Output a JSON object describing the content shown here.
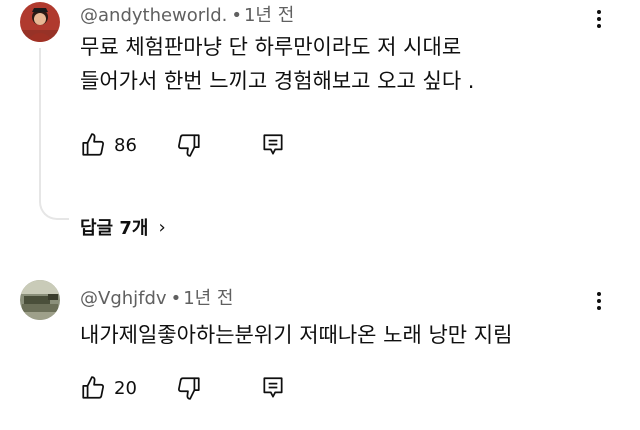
{
  "comments": [
    {
      "author": "@andytheworld.",
      "separator": "•",
      "time": "1년 전",
      "text_lines": [
        "무료 체험판마냥 단 하루만이라도 저 시대로",
        "들어가서 한번 느끼고 경험해보고 오고 싶다 ."
      ],
      "likes": "86",
      "replies_label": "답글 7개",
      "replies_chevron": "›",
      "icons": [
        "thumbs-up-icon",
        "thumbs-down-icon",
        "reply-icon",
        "more-vert-icon"
      ]
    },
    {
      "author": "@Vghjfdv",
      "separator": "•",
      "time": "1년 전",
      "text_lines": [
        "내가제일좋아하는분위기 저때나온 노래 낭만 지림"
      ],
      "likes": "20",
      "icons": [
        "thumbs-up-icon",
        "thumbs-down-icon",
        "reply-icon",
        "more-vert-icon"
      ]
    }
  ],
  "colors": {
    "text": "#0f0f0f",
    "meta": "#606060",
    "thread_line": "#e6e6e6",
    "background": "#ffffff"
  }
}
